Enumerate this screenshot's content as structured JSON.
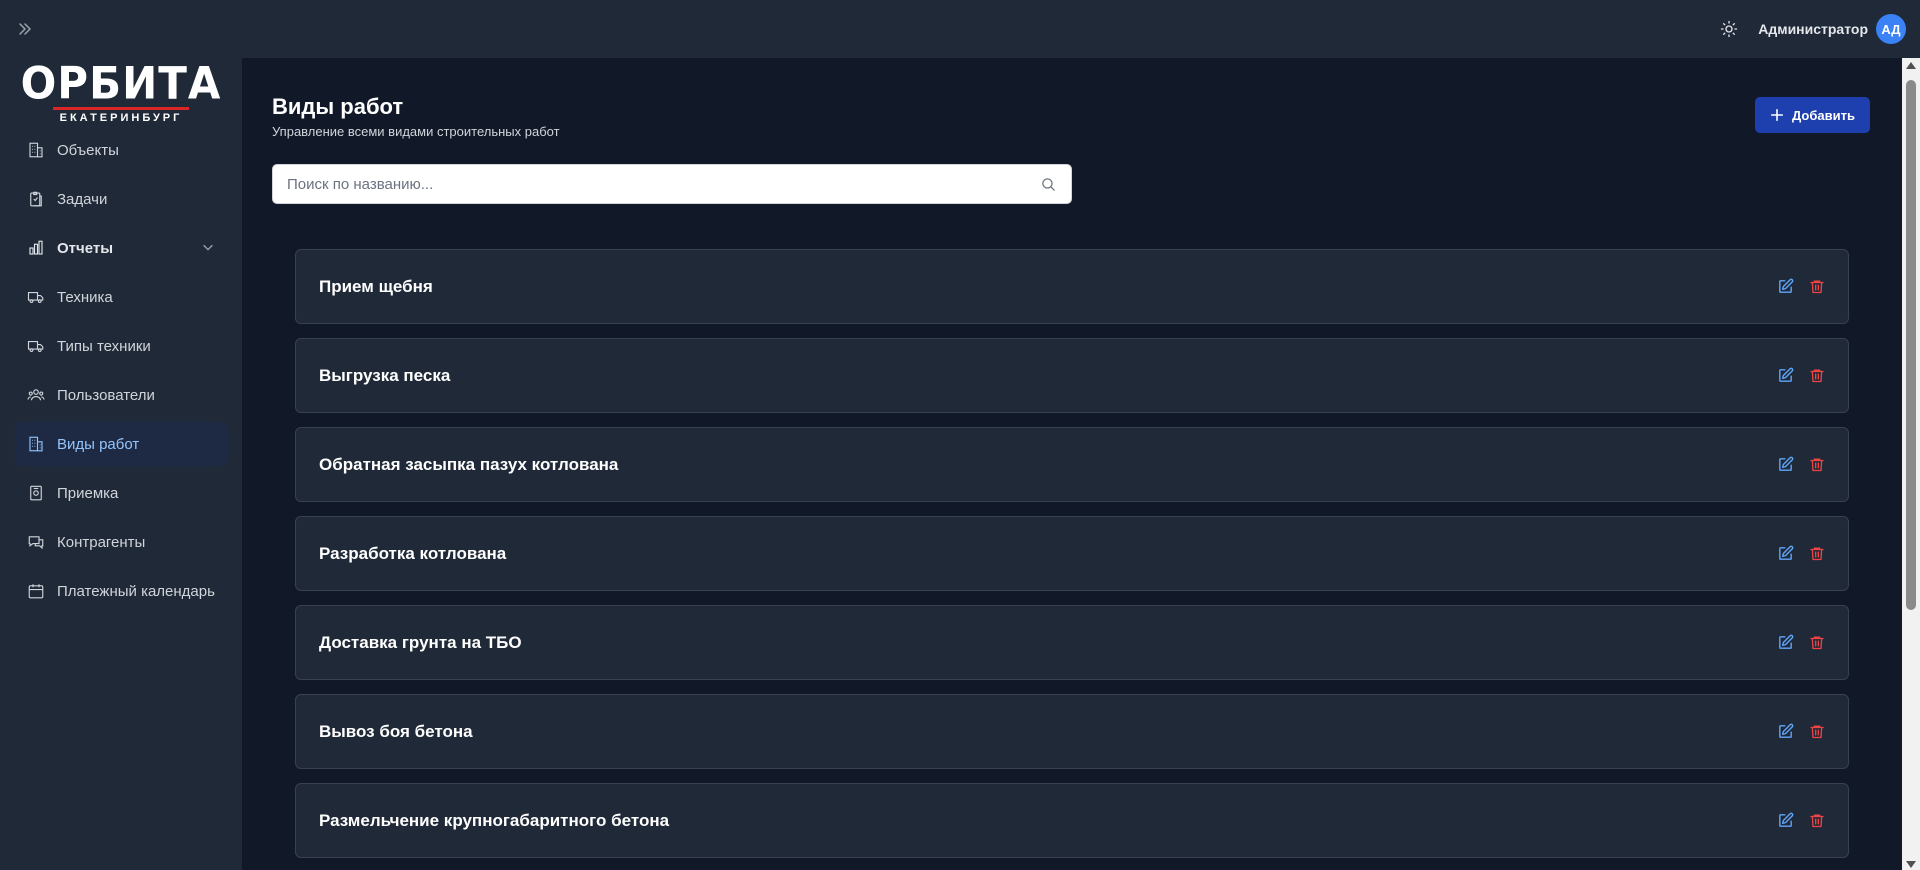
{
  "header": {
    "user_name": "Администратор",
    "avatar_initials": "АД"
  },
  "logo": {
    "main": "ОРБИТА",
    "sub": "ЕКАТЕРИНБУРГ"
  },
  "sidebar": {
    "items": [
      {
        "label": "Объекты",
        "icon": "building-icon"
      },
      {
        "label": "Задачи",
        "icon": "clipboard-icon"
      },
      {
        "label": "Отчеты",
        "icon": "bar-chart-icon"
      },
      {
        "label": "Техника",
        "icon": "truck-icon"
      },
      {
        "label": "Типы техники",
        "icon": "truck-icon"
      },
      {
        "label": "Пользователи",
        "icon": "users-icon"
      },
      {
        "label": "Виды работ",
        "icon": "building-icon"
      },
      {
        "label": "Приемка",
        "icon": "document-check-icon"
      },
      {
        "label": "Контрагенты",
        "icon": "chat-icon"
      },
      {
        "label": "Платежный календарь",
        "icon": "calendar-icon"
      }
    ],
    "active_index": 6
  },
  "page": {
    "title": "Виды работ",
    "subtitle": "Управление всеми видами строительных работ",
    "add_label": "Добавить",
    "search_placeholder": "Поиск по названию..."
  },
  "work_types": [
    "Прием щебня",
    "Выгрузка песка",
    "Обратная засыпка пазух котлована",
    "Разработка котлована",
    "Доставка грунта на ТБО",
    "Вывоз боя бетона",
    "Размельчение крупногабаритного бетона"
  ],
  "colors": {
    "accent": "#1e40af",
    "edit": "#60a5fa",
    "delete": "#ef4444",
    "logo_line": "#dc2626"
  }
}
